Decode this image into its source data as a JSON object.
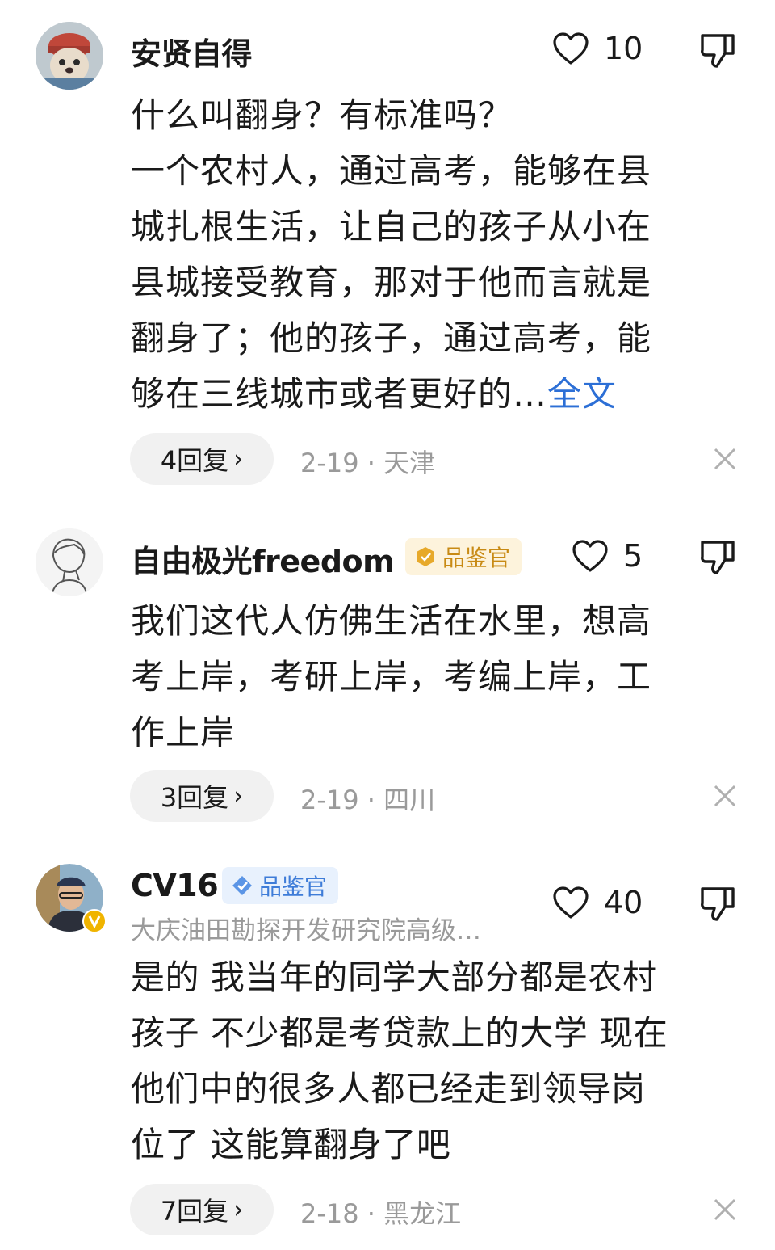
{
  "comments": [
    {
      "user": "安贤自得",
      "badge": null,
      "likes": "10",
      "lines": [
        "什么叫翻身？有标准吗？",
        "一个农村人，通过高考，能够在县",
        "城扎根生活，让自己的孩子从小在",
        "县城接受教育，那对于他而言就是",
        "翻身了；他的孩子，通过高考，能",
        "够在三线城市或者更好的…"
      ],
      "more": "全文",
      "replies": "4回复",
      "date": "2-19",
      "location": "天津",
      "avatar_icon": "dog-hat-avatar"
    },
    {
      "user": "自由极光freedom",
      "badge": "品鉴官",
      "badge_color": "#c88a14",
      "likes": "5",
      "lines": [
        "我们这代人仿佛生活在水里，想高",
        "考上岸，考研上岸，考编上岸，工",
        "作上岸"
      ],
      "replies": "3回复",
      "date": "2-19",
      "location": "四川",
      "avatar_icon": "sketch-boy-avatar"
    },
    {
      "user": "CV16",
      "badge": "品鉴官",
      "badge_color": "#3e7cd8",
      "subtitle": "大庆油田勘探开发研究院高级…",
      "likes": "40",
      "lines": [
        "是的 我当年的同学大部分都是农村",
        "孩子 不少都是考贷款上的大学 现在",
        "他们中的很多人都已经走到领导岗",
        "位了 这能算翻身了吧"
      ],
      "replies": "7回复",
      "date": "2-18",
      "location": "黑龙江",
      "avatar_icon": "verified-photo-avatar"
    }
  ],
  "meta_separator": "·",
  "reply_chevron": "›",
  "icons": [
    "heart-icon",
    "thumb-down-icon",
    "close-icon",
    "verified-v-icon"
  ]
}
